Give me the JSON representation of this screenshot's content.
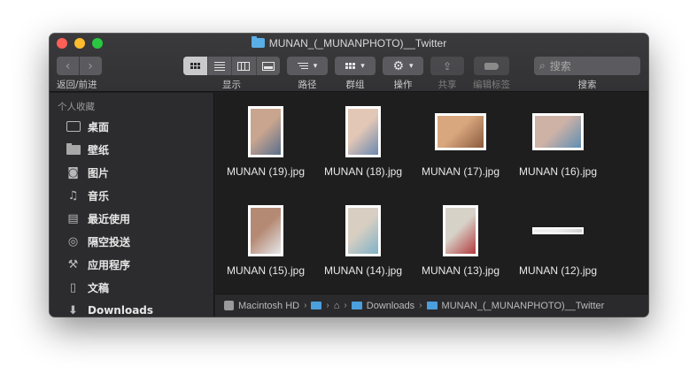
{
  "window": {
    "title": "MUNAN_(_MUNANPHOTO)__Twitter"
  },
  "toolbar": {
    "back_forward_label": "返回/前进",
    "view_label": "显示",
    "path_label": "路径",
    "group_label": "群组",
    "action_label": "操作",
    "share_label": "共享",
    "edit_tags_label": "编辑标签",
    "search_label": "搜索",
    "search_placeholder": "搜索",
    "back_icon": "chevron-left-icon",
    "forward_icon": "chevron-right-icon",
    "share_icon": "share-icon",
    "action_icon": "gear-icon"
  },
  "sidebar": {
    "section_title": "个人收藏",
    "items": [
      {
        "label": "桌面",
        "icon": "desktop-icon"
      },
      {
        "label": "壁纸",
        "icon": "folder-icon"
      },
      {
        "label": "图片",
        "icon": "camera-icon"
      },
      {
        "label": "音乐",
        "icon": "music-icon"
      },
      {
        "label": "最近使用",
        "icon": "recents-icon"
      },
      {
        "label": "隔空投送",
        "icon": "airdrop-icon"
      },
      {
        "label": "应用程序",
        "icon": "applications-icon"
      },
      {
        "label": "文稿",
        "icon": "documents-icon"
      },
      {
        "label": "Downloads",
        "icon": "downloads-icon"
      }
    ]
  },
  "files": [
    {
      "name": "MUNAN (19).jpg",
      "colors": [
        "#c9a58f",
        "#5a6f8c"
      ]
    },
    {
      "name": "MUNAN (18).jpg",
      "colors": [
        "#e3c7b6",
        "#6a89b0"
      ]
    },
    {
      "name": "MUNAN (17).jpg",
      "colors": [
        "#d8a77e",
        "#8b5a3d"
      ]
    },
    {
      "name": "MUNAN (16).jpg",
      "colors": [
        "#cfb2a6",
        "#5f8fb3"
      ]
    },
    {
      "name": "MUNAN (15).jpg",
      "colors": [
        "#b58a74",
        "#e6e8ea"
      ]
    },
    {
      "name": "MUNAN (14).jpg",
      "colors": [
        "#d8cfc2",
        "#7fb2c7"
      ]
    },
    {
      "name": "MUNAN (13).jpg",
      "colors": [
        "#d7d2c8",
        "#b33a3e"
      ]
    },
    {
      "name": "MUNAN (12).jpg",
      "colors": [
        "#efefef",
        "#cfcfcf"
      ]
    }
  ],
  "pathbar": {
    "items": [
      "Macintosh HD",
      "",
      "",
      "Downloads",
      "MUNAN_(_MUNANPHOTO)__Twitter"
    ]
  }
}
